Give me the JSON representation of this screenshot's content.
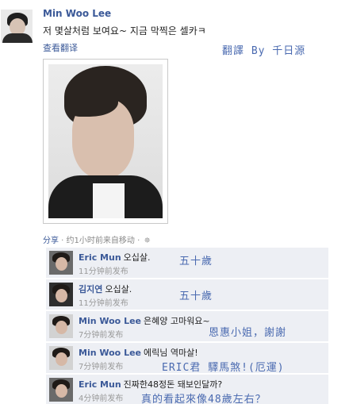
{
  "post": {
    "author": "Min Woo Lee",
    "text": "저 몇살처럼 보여요~ 지금 막찍은 셀카ㅋ",
    "translate_label": "查看翻译",
    "credit_note": "翻譯 By 千日源",
    "share_label": "分享",
    "meta": " · 约1小时前来自移动 ·"
  },
  "comments": [
    {
      "name": "Eric Mun",
      "text": "오십살.",
      "time": "11分钟前发布",
      "note": "五十歲"
    },
    {
      "name": "김지연",
      "text": "오십살.",
      "time": "11分钟前发布",
      "note": "五十歲"
    },
    {
      "name": "Min Woo Lee",
      "text": "은혜양 고마워요~",
      "time": "7分钟前发布",
      "note": "恩惠小姐，謝謝"
    },
    {
      "name": "Min Woo Lee",
      "text": "에릭님 역마살!",
      "time": "7分钟前发布",
      "note": "ERIC君 驛馬煞!(厄運)"
    },
    {
      "name": "Eric Mun",
      "text": "진짜한48정돈 돼보인달까?",
      "time": "4分钟前发布",
      "note": "真的看起來像48歲左右？"
    }
  ]
}
